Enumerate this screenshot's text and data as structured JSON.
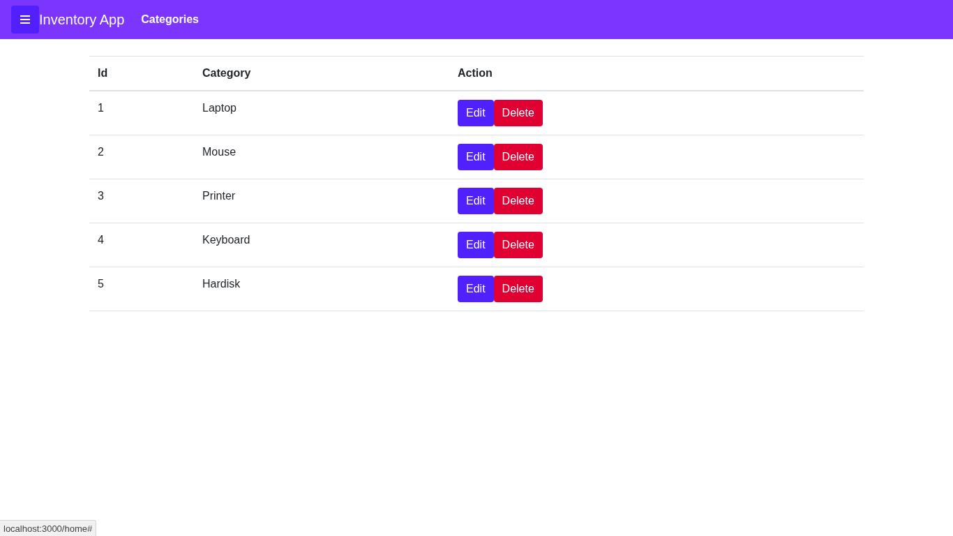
{
  "navbar": {
    "brand": "Inventory App",
    "links": [
      {
        "label": "Categories"
      }
    ]
  },
  "table": {
    "columns": [
      "Id",
      "Category",
      "Action"
    ],
    "rows": [
      {
        "id": "1",
        "category": "Laptop",
        "actions": [
          {
            "kind": "edit",
            "label": "Edit"
          },
          {
            "kind": "delete",
            "label": "Delete"
          }
        ]
      },
      {
        "id": "2",
        "category": "Mouse",
        "actions": [
          {
            "kind": "edit",
            "label": "Edit"
          },
          {
            "kind": "delete",
            "label": "Delete"
          }
        ]
      },
      {
        "id": "3",
        "category": "Printer",
        "actions": [
          {
            "kind": "edit",
            "label": "Edit"
          },
          {
            "kind": "delete",
            "label": "Delete"
          }
        ]
      },
      {
        "id": "4",
        "category": "Keyboard",
        "actions": [
          {
            "kind": "edit",
            "label": "Edit"
          },
          {
            "kind": "delete",
            "label": "Delete"
          }
        ]
      },
      {
        "id": "5",
        "category": "Hardisk",
        "actions": [
          {
            "kind": "edit",
            "label": "Edit"
          },
          {
            "kind": "delete",
            "label": "Delete"
          }
        ]
      }
    ]
  },
  "status_bar": {
    "url": "localhost:3000/home#"
  }
}
